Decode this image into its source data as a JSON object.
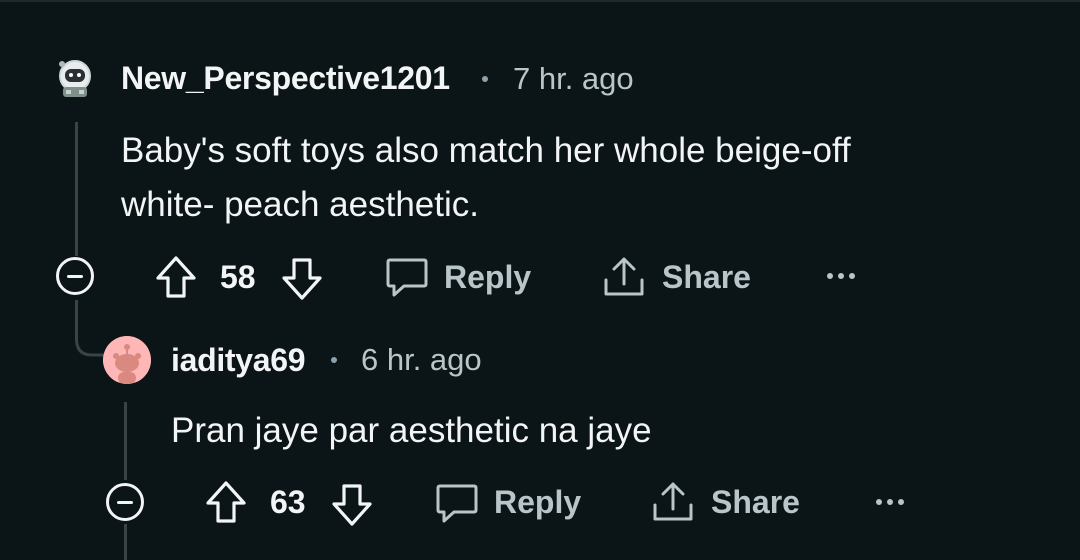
{
  "comments": [
    {
      "author": "New_Perspective1201",
      "time": "7 hr. ago",
      "body_lines": [
        "Baby's soft toys also match her whole beige-off",
        "white- peach aesthetic."
      ],
      "votes": "58",
      "reply_label": "Reply",
      "share_label": "Share"
    },
    {
      "author": "iaditya69",
      "time": "6 hr. ago",
      "body_lines": [
        "Pran jaye par aesthetic na jaye"
      ],
      "votes": "63",
      "reply_label": "Reply",
      "share_label": "Share"
    }
  ],
  "icons": {
    "collapse": "minus-circle-icon",
    "upvote": "arrow-up-icon",
    "downvote": "arrow-down-icon",
    "reply": "speech-bubble-icon",
    "share": "share-icon",
    "more": "ellipsis-icon"
  },
  "colors": {
    "background": "#0b1416",
    "text": "#f2f4f5",
    "muted": "#b8c5c9",
    "thread_line": "#3a4448",
    "avatar_2": "#ffb6b6"
  }
}
